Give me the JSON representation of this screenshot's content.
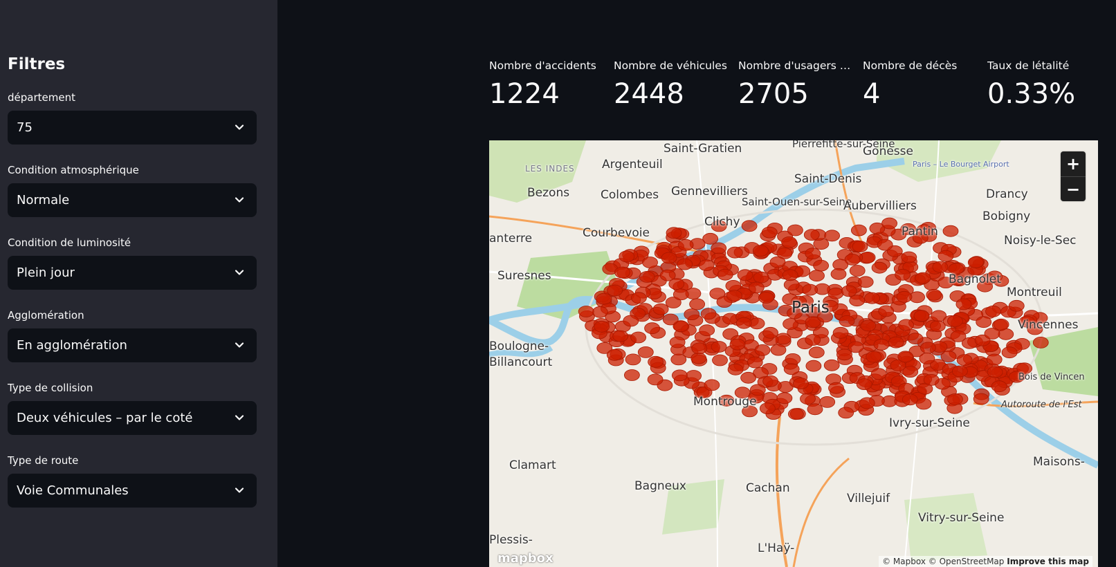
{
  "sidebar": {
    "title": "Filtres",
    "filters": [
      {
        "label": "département",
        "value": "75"
      },
      {
        "label": "Condition atmosphérique",
        "value": "Normale"
      },
      {
        "label": "Condition de luminosité",
        "value": "Plein jour"
      },
      {
        "label": "Agglomération",
        "value": "En agglomération"
      },
      {
        "label": "Type de collision",
        "value": "Deux véhicules – par le coté"
      },
      {
        "label": "Type de route",
        "value": "Voie Communales"
      }
    ]
  },
  "metrics": [
    {
      "label": "Nombre d'accidents",
      "value": "1224"
    },
    {
      "label": "Nombre de véhicules",
      "value": "2448"
    },
    {
      "label": "Nombre d'usagers impliqués",
      "value": "2705"
    },
    {
      "label": "Nombre de décès",
      "value": "4"
    },
    {
      "label": "Taux de létalité",
      "value": "0.33%"
    }
  ],
  "map": {
    "zoom_in": "+",
    "zoom_out": "−",
    "attribution": "© Mapbox © OpenStreetMap",
    "improve": "Improve this map",
    "logo": "mapbox",
    "point_color": "#cc1f00",
    "labels": {
      "paris": "Paris",
      "argenteuil": "Argenteuil",
      "saint_denis": "Saint-Denis",
      "colombes": "Colombes",
      "gennevilliers": "Gennevilliers",
      "bezons": "Bezons",
      "aubervilliers": "Aubervilliers",
      "drancy": "Drancy",
      "bobigny": "Bobigny",
      "clichy": "Clichy",
      "saint_ouen": "Saint-Ouen-sur-Seine",
      "courbevoie": "Courbevoie",
      "pantin": "Pantin",
      "noisy": "Noisy-le-Sec",
      "suresnes": "Suresnes",
      "bagnolet": "Bagnolet",
      "montreuil": "Montreuil",
      "vincennes": "Vincennes",
      "boulogne": "Boulogne-Billancourt",
      "montrouge": "Montrouge",
      "ivry": "Ivry-sur-Seine",
      "clamart": "Clamart",
      "bagneux": "Bagneux",
      "cachan": "Cachan",
      "villejuif": "Villejuif",
      "vitry": "Vitry-sur-Seine",
      "maisons": "Maisons-",
      "gonesse": "Gonesse",
      "pierrefitte": "Pierrefitte-sur-Seine",
      "saint_gratien": "Saint-Gratien",
      "nanterre": "anterre",
      "les_indes": "LES INDES",
      "bourget": "Paris – Le Bourget Airport",
      "bois_vincennes": "Bois de Vincen",
      "autoroute_est": "Autoroute de l'Est",
      "lhay": "L'Haÿ-",
      "plessis": "Plessis-"
    }
  }
}
